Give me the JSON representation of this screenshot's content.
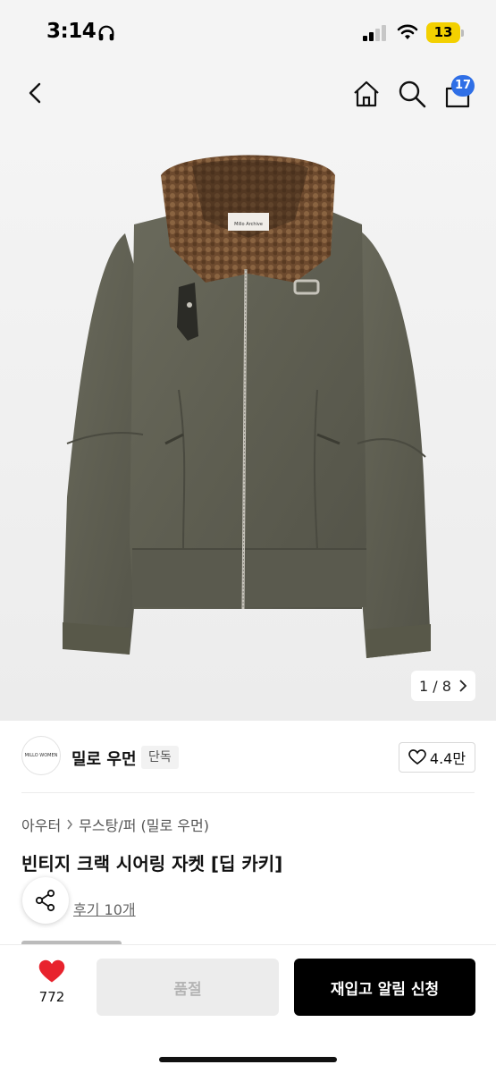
{
  "status_bar": {
    "time": "3:14",
    "battery": "13",
    "icons": [
      "headphone-icon",
      "signal-icon",
      "wifi-icon",
      "battery-icon"
    ]
  },
  "header": {
    "icons": [
      "back-icon",
      "home-icon",
      "search-icon",
      "cart-icon"
    ],
    "cart_count": "17"
  },
  "product_image": {
    "label_text": "Millo Archive",
    "counter": "1 / 8"
  },
  "brand": {
    "logo_text": "MILLO WOMEN",
    "name": "밀로 우먼",
    "tag": "단독",
    "likes": "4.4만"
  },
  "breadcrumb": {
    "category": "아우터",
    "subcategory": "무스탕/퍼 (밀로 우먼)"
  },
  "product": {
    "title": "빈티지 크랙 시어링 자켓 [딥 카키]",
    "review_link": "후기 10개"
  },
  "bottom_bar": {
    "wish_count": "772",
    "soldout_label": "품절",
    "notify_label": "재입고 알림 신청"
  },
  "colors": {
    "accent": "#2f6fe6",
    "heart": "#e8232d",
    "battery": "#f3d000",
    "primary_button": "#000000"
  }
}
